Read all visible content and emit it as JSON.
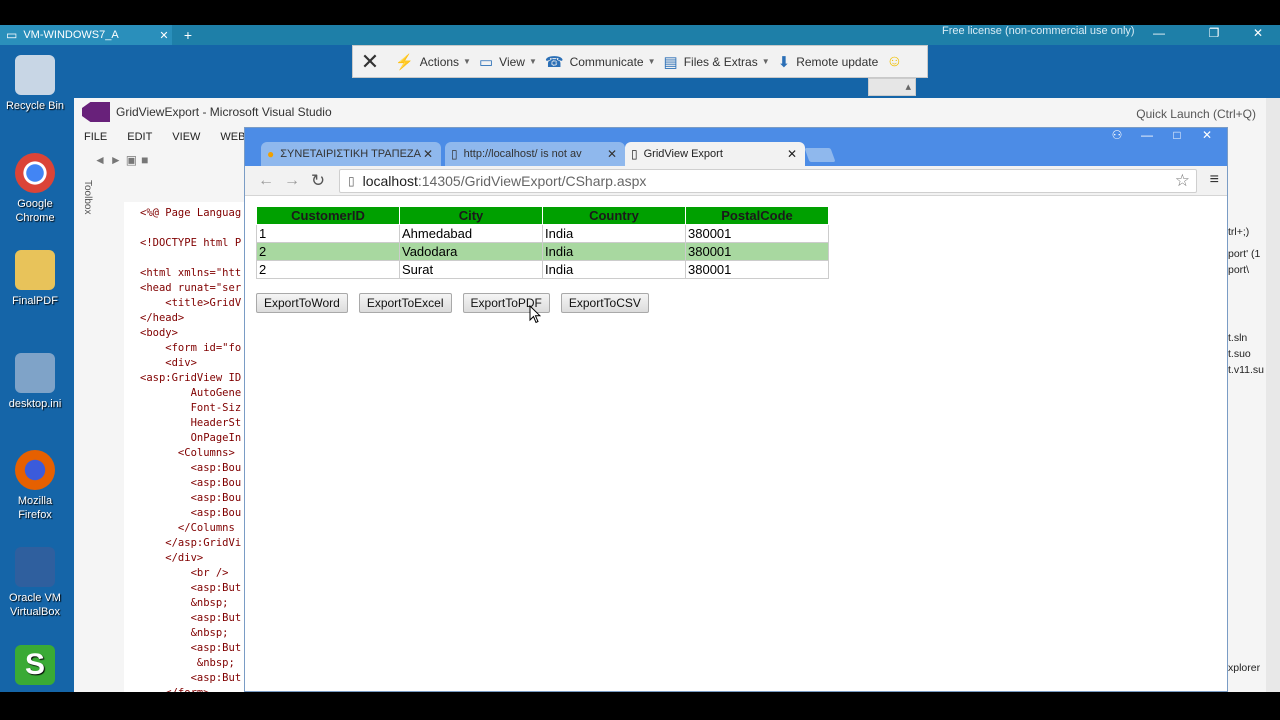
{
  "tv": {
    "session_tab": "VM-WINDOWS7_A",
    "license": "Free license (non-commercial use only)",
    "toolbar": [
      {
        "label": "Actions",
        "icon": "lightning-icon"
      },
      {
        "label": "View",
        "icon": "monitor-icon"
      },
      {
        "label": "Communicate",
        "icon": "phone-icon"
      },
      {
        "label": "Files & Extras",
        "icon": "file-icon"
      },
      {
        "label": "Remote update",
        "icon": "download-icon"
      }
    ]
  },
  "desktop": {
    "icons": [
      {
        "label": "Recycle Bin",
        "color": "#c8d6e5"
      },
      {
        "label": "Google Chrome",
        "color": "#db4437"
      },
      {
        "label": "FinalPDF",
        "color": "#e8c35a"
      },
      {
        "label": "desktop.ini",
        "color": "#7fa3c8"
      },
      {
        "label": "Mozilla Firefox",
        "color": "#e66000"
      },
      {
        "label": "Oracle VM VirtualBox",
        "color": "#2f5f9e"
      },
      {
        "label": "",
        "color": "#3aaa35"
      }
    ]
  },
  "vs": {
    "title": "GridViewExport - Microsoft Visual Studio",
    "quick_launch": "Quick Launch (Ctrl+Q)",
    "menu": [
      "FILE",
      "EDIT",
      "VIEW",
      "WEBSIT"
    ],
    "toolbox": "Toolbox",
    "code": [
      "<%@ Page Languag",
      "",
      "<!DOCTYPE html P",
      "",
      "<html xmlns=\"htt",
      "<head runat=\"ser",
      "    <title>GridV",
      "</head>",
      "<body>",
      "    <form id=\"fo",
      "    <div>",
      "<asp:GridView ID",
      "        AutoGene",
      "        Font-Siz",
      "        HeaderSt",
      "        OnPageIn",
      "      <Columns>",
      "        <asp:Bou",
      "        <asp:Bou",
      "        <asp:Bou",
      "        <asp:Bou",
      "      </Columns",
      "    </asp:GridVi",
      "    </div>",
      "        <br />",
      "        <asp:But",
      "        &nbsp;",
      "        <asp:But",
      "        &nbsp;",
      "        <asp:But",
      "         &nbsp;",
      "        <asp:But",
      "    </form>"
    ],
    "right_panel": [
      "trl+;)",
      "port' (1",
      "port\\",
      "t.sln",
      "t.suo",
      "t.v11.su",
      "xplorer"
    ]
  },
  "chrome": {
    "tabs": [
      {
        "label": "ΣΥΝΕΤΑΙΡΙΣΤΙΚΗ ΤΡΑΠΕΖΑ",
        "icon": "bank-favicon-icon"
      },
      {
        "label": "http://localhost/ is not av",
        "icon": "page-icon"
      },
      {
        "label": "GridView Export",
        "icon": "page-icon"
      }
    ],
    "url_host": "localhost",
    "url_rest": ":14305/GridViewExport/CSharp.aspx"
  },
  "grid": {
    "columns": [
      "CustomerID",
      "City",
      "Country",
      "PostalCode"
    ],
    "rows": [
      [
        "1",
        "Ahmedabad",
        "India",
        "380001"
      ],
      [
        "2",
        "Vadodara",
        "India",
        "380001"
      ],
      [
        "2",
        "Surat",
        "India",
        "380001"
      ]
    ],
    "header_color": "#00a000",
    "alt_row_color": "#a8d8a0"
  },
  "buttons": [
    "ExportToWord",
    "ExportToExcel",
    "ExportToPDF",
    "ExportToCSV"
  ]
}
